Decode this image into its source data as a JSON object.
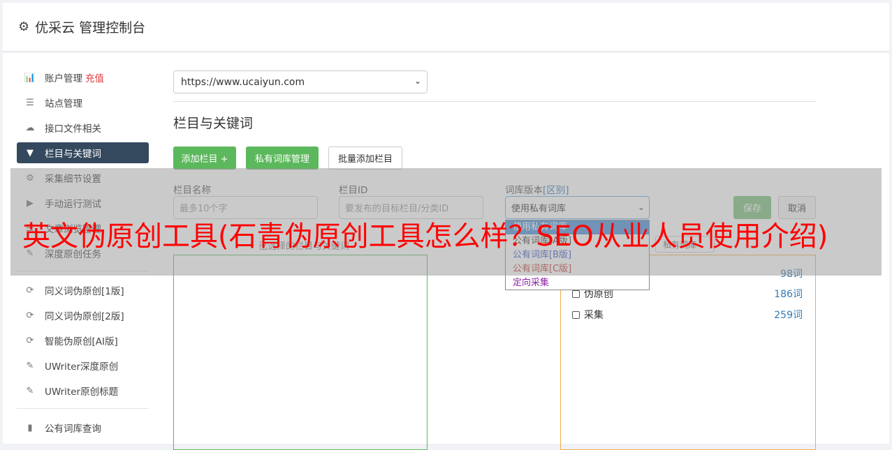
{
  "header": {
    "title": "优采云 管理控制台"
  },
  "sidebar": {
    "items": [
      {
        "label": "账户管理",
        "badge": "充值",
        "icon": "bar-chart-icon",
        "glyph": "📊"
      },
      {
        "label": "站点管理",
        "icon": "server-icon",
        "glyph": "☰"
      },
      {
        "label": "接口文件相关",
        "icon": "cloud-upload-icon",
        "glyph": "☁"
      },
      {
        "label": "栏目与关键词",
        "icon": "filter-icon",
        "glyph": "▼",
        "active": true
      },
      {
        "label": "采集细节设置",
        "icon": "gears-icon",
        "glyph": "⚙"
      },
      {
        "label": "手动运行测试",
        "icon": "play-circle-icon",
        "glyph": "▶"
      },
      {
        "label": "文章浏览管理",
        "icon": "list-icon",
        "glyph": "☰"
      },
      {
        "label": "深度原创任务",
        "icon": "edit-icon",
        "glyph": "✎"
      },
      {
        "label": "同义词伪原创[1版]",
        "icon": "refresh-icon",
        "glyph": "⟳"
      },
      {
        "label": "同义词伪原创[2版]",
        "icon": "refresh-icon",
        "glyph": "⟳"
      },
      {
        "label": "智能伪原创[AI版]",
        "icon": "refresh-icon",
        "glyph": "⟳"
      },
      {
        "label": "UWriter深度原创",
        "icon": "edit-icon",
        "glyph": "✎"
      },
      {
        "label": "UWriter原创标题",
        "icon": "edit-icon",
        "glyph": "✎"
      },
      {
        "label": "公有词库查询",
        "icon": "book-icon",
        "glyph": "▮"
      }
    ]
  },
  "main": {
    "site_select": "https://www.ucaiyun.com",
    "section_title": "栏目与关键词",
    "buttons": {
      "add_column": "添加栏目 +",
      "private_lib": "私有词库管理",
      "batch_add": "批量添加栏目"
    },
    "form": {
      "name_label": "栏目名称",
      "name_placeholder": "最多10个字",
      "id_label": "栏目ID",
      "id_placeholder": "要发布的目标栏目/分类ID",
      "version_label": "词库版本",
      "version_label_extra": "[区别]",
      "version_value": "使用私有词库",
      "save": "保存",
      "cancel": "取消"
    },
    "sub_hint": "已选择的栏目与关键词",
    "small_select": "私有词库",
    "dropdown": [
      {
        "label": "使用私有词库",
        "color": "#ffffff",
        "selected": true
      },
      {
        "label": "公有词库[A版]",
        "color": "#333333"
      },
      {
        "label": "公有词库[B版]",
        "color": "#3355cc"
      },
      {
        "label": "公有词库[C版]",
        "color": "#c0392b"
      },
      {
        "label": "定向采集",
        "color": "#8e24aa"
      }
    ],
    "libraries": [
      {
        "label": "",
        "count": "98词"
      },
      {
        "label": "伪原创",
        "count": "186词"
      },
      {
        "label": "采集",
        "count": "259词"
      }
    ]
  },
  "overlay": {
    "text": "英文伪原创工具(石青伪原创工具怎么样？SEO从业人员使用介绍)"
  }
}
